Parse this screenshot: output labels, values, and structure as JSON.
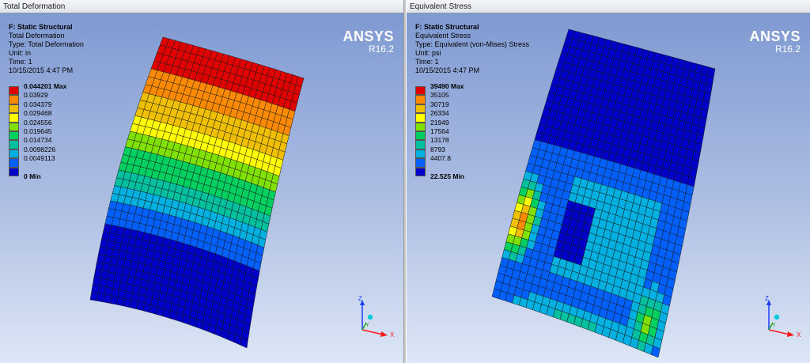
{
  "left": {
    "window_title": "Total Deformation",
    "analysis": "F: Static Structural",
    "result_name": "Total Deformation",
    "type_line": "Type: Total Deformation",
    "unit_line": "Unit: in",
    "time_line": "Time: 1",
    "datetime": "10/15/2015 4:47 PM",
    "legend": [
      "0.044201 Max",
      "0.03929",
      "0.034379",
      "0.029468",
      "0.024556",
      "0.019645",
      "0.014734",
      "0.0098226",
      "0.0049113",
      "0 Min"
    ]
  },
  "right": {
    "window_title": "Equivalent Stress",
    "analysis": "F: Static Structural",
    "result_name": "Equivalent Stress",
    "type_line": "Type: Equivalent (von-Mises) Stress",
    "unit_line": "Unit: psi",
    "time_line": "Time: 1",
    "datetime": "10/15/2015 4:47 PM",
    "legend": [
      "39490 Max",
      "35105",
      "30719",
      "26334",
      "21949",
      "17564",
      "13178",
      "8793",
      "4407.8",
      "22.525 Min"
    ]
  },
  "brand": {
    "name": "ANSYS",
    "version": "R16.2"
  },
  "triad": {
    "x_label": "X",
    "y_label": "Y",
    "z_label": "Z"
  },
  "legend_colors": [
    "#e00000",
    "#ff8a00",
    "#f0c000",
    "#ffff00",
    "#80e000",
    "#00d060",
    "#00c0a0",
    "#00b0e0",
    "#0060ff",
    "#0000c8"
  ],
  "colors": {
    "mesh_line": "#1a1a1a",
    "background_top": "#7f9ad2",
    "background_bottom": "#dde6f6"
  }
}
